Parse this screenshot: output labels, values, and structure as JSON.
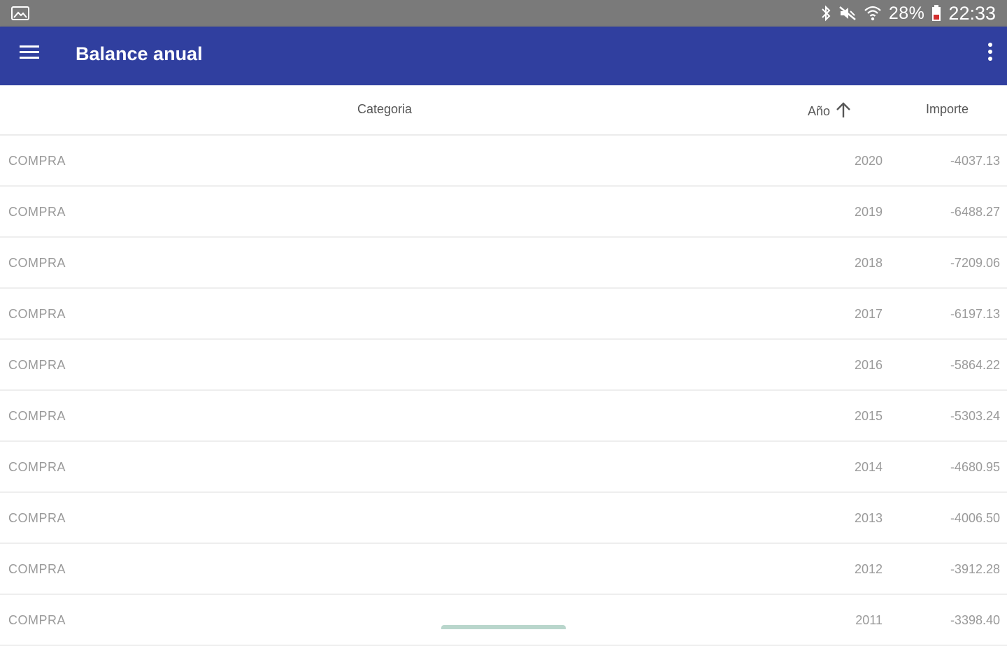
{
  "status_bar": {
    "battery": "28%",
    "time": "22:33",
    "icons": [
      "gallery-icon",
      "bluetooth-icon",
      "mute-icon",
      "wifi-icon",
      "battery-icon"
    ]
  },
  "app_bar": {
    "title": "Balance anual",
    "color": "#303f9f",
    "icons": [
      "menu-icon",
      "more-vert-icon"
    ]
  },
  "table": {
    "headers": {
      "categoria": "Categoria",
      "anio": "Año",
      "importe": "Importe"
    },
    "sort_icon": "arrow-up-icon",
    "rows": [
      {
        "categoria": "COMPRA",
        "anio": "2020",
        "importe": "-4037.13"
      },
      {
        "categoria": "COMPRA",
        "anio": "2019",
        "importe": "-6488.27"
      },
      {
        "categoria": "COMPRA",
        "anio": "2018",
        "importe": "-7209.06"
      },
      {
        "categoria": "COMPRA",
        "anio": "2017",
        "importe": "-6197.13"
      },
      {
        "categoria": "COMPRA",
        "anio": "2016",
        "importe": "-5864.22"
      },
      {
        "categoria": "COMPRA",
        "anio": "2015",
        "importe": "-5303.24"
      },
      {
        "categoria": "COMPRA",
        "anio": "2014",
        "importe": "-4680.95"
      },
      {
        "categoria": "COMPRA",
        "anio": "2013",
        "importe": "-4006.50"
      },
      {
        "categoria": "COMPRA",
        "anio": "2012",
        "importe": "-3912.28"
      },
      {
        "categoria": "COMPRA",
        "anio": "2011",
        "importe": "-3398.40"
      }
    ]
  }
}
